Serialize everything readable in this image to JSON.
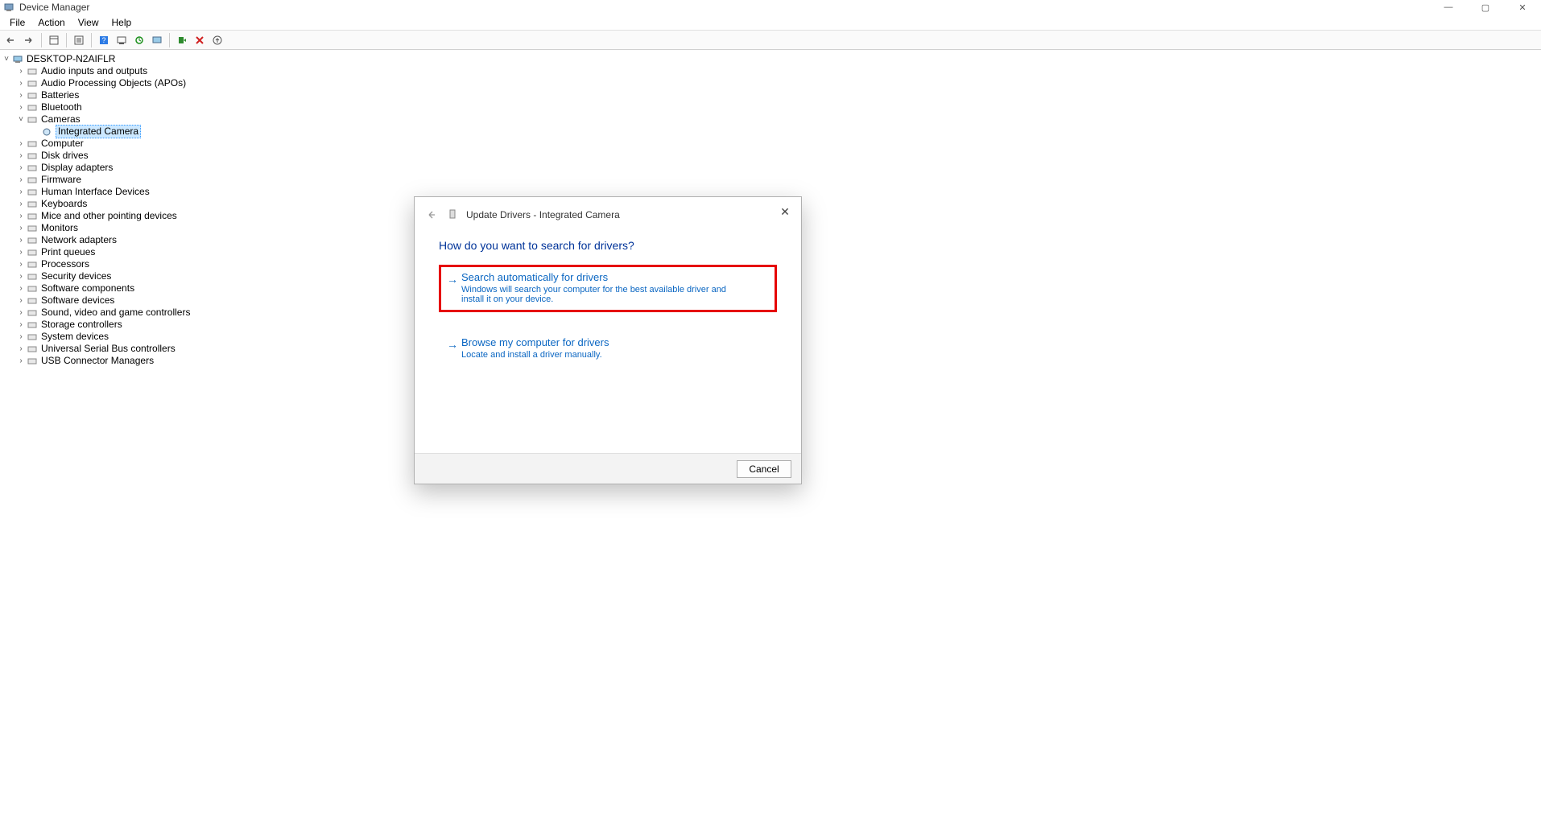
{
  "window": {
    "title": "Device Manager",
    "controls": {
      "min": "—",
      "max": "▢",
      "close": "✕"
    }
  },
  "menu": [
    "File",
    "Action",
    "View",
    "Help"
  ],
  "root": {
    "name": "DESKTOP-N2AIFLR"
  },
  "categories": [
    {
      "label": "Audio inputs and outputs",
      "expand": ">"
    },
    {
      "label": "Audio Processing Objects (APOs)",
      "expand": ">"
    },
    {
      "label": "Batteries",
      "expand": ">"
    },
    {
      "label": "Bluetooth",
      "expand": ">"
    },
    {
      "label": "Cameras",
      "expand": "v",
      "child": "Integrated Camera"
    },
    {
      "label": "Computer",
      "expand": ">"
    },
    {
      "label": "Disk drives",
      "expand": ">"
    },
    {
      "label": "Display adapters",
      "expand": ">"
    },
    {
      "label": "Firmware",
      "expand": ">"
    },
    {
      "label": "Human Interface Devices",
      "expand": ">"
    },
    {
      "label": "Keyboards",
      "expand": ">"
    },
    {
      "label": "Mice and other pointing devices",
      "expand": ">"
    },
    {
      "label": "Monitors",
      "expand": ">"
    },
    {
      "label": "Network adapters",
      "expand": ">"
    },
    {
      "label": "Print queues",
      "expand": ">"
    },
    {
      "label": "Processors",
      "expand": ">"
    },
    {
      "label": "Security devices",
      "expand": ">"
    },
    {
      "label": "Software components",
      "expand": ">"
    },
    {
      "label": "Software devices",
      "expand": ">"
    },
    {
      "label": "Sound, video and game controllers",
      "expand": ">"
    },
    {
      "label": "Storage controllers",
      "expand": ">"
    },
    {
      "label": "System devices",
      "expand": ">"
    },
    {
      "label": "Universal Serial Bus controllers",
      "expand": ">"
    },
    {
      "label": "USB Connector Managers",
      "expand": ">"
    }
  ],
  "dialog": {
    "title": "Update Drivers - Integrated Camera",
    "question": "How do you want to search for drivers?",
    "option1": {
      "title": "Search automatically for drivers",
      "desc": "Windows will search your computer for the best available driver and install it on your device."
    },
    "option2": {
      "title": "Browse my computer for drivers",
      "desc": "Locate and install a driver manually."
    },
    "cancel": "Cancel"
  }
}
